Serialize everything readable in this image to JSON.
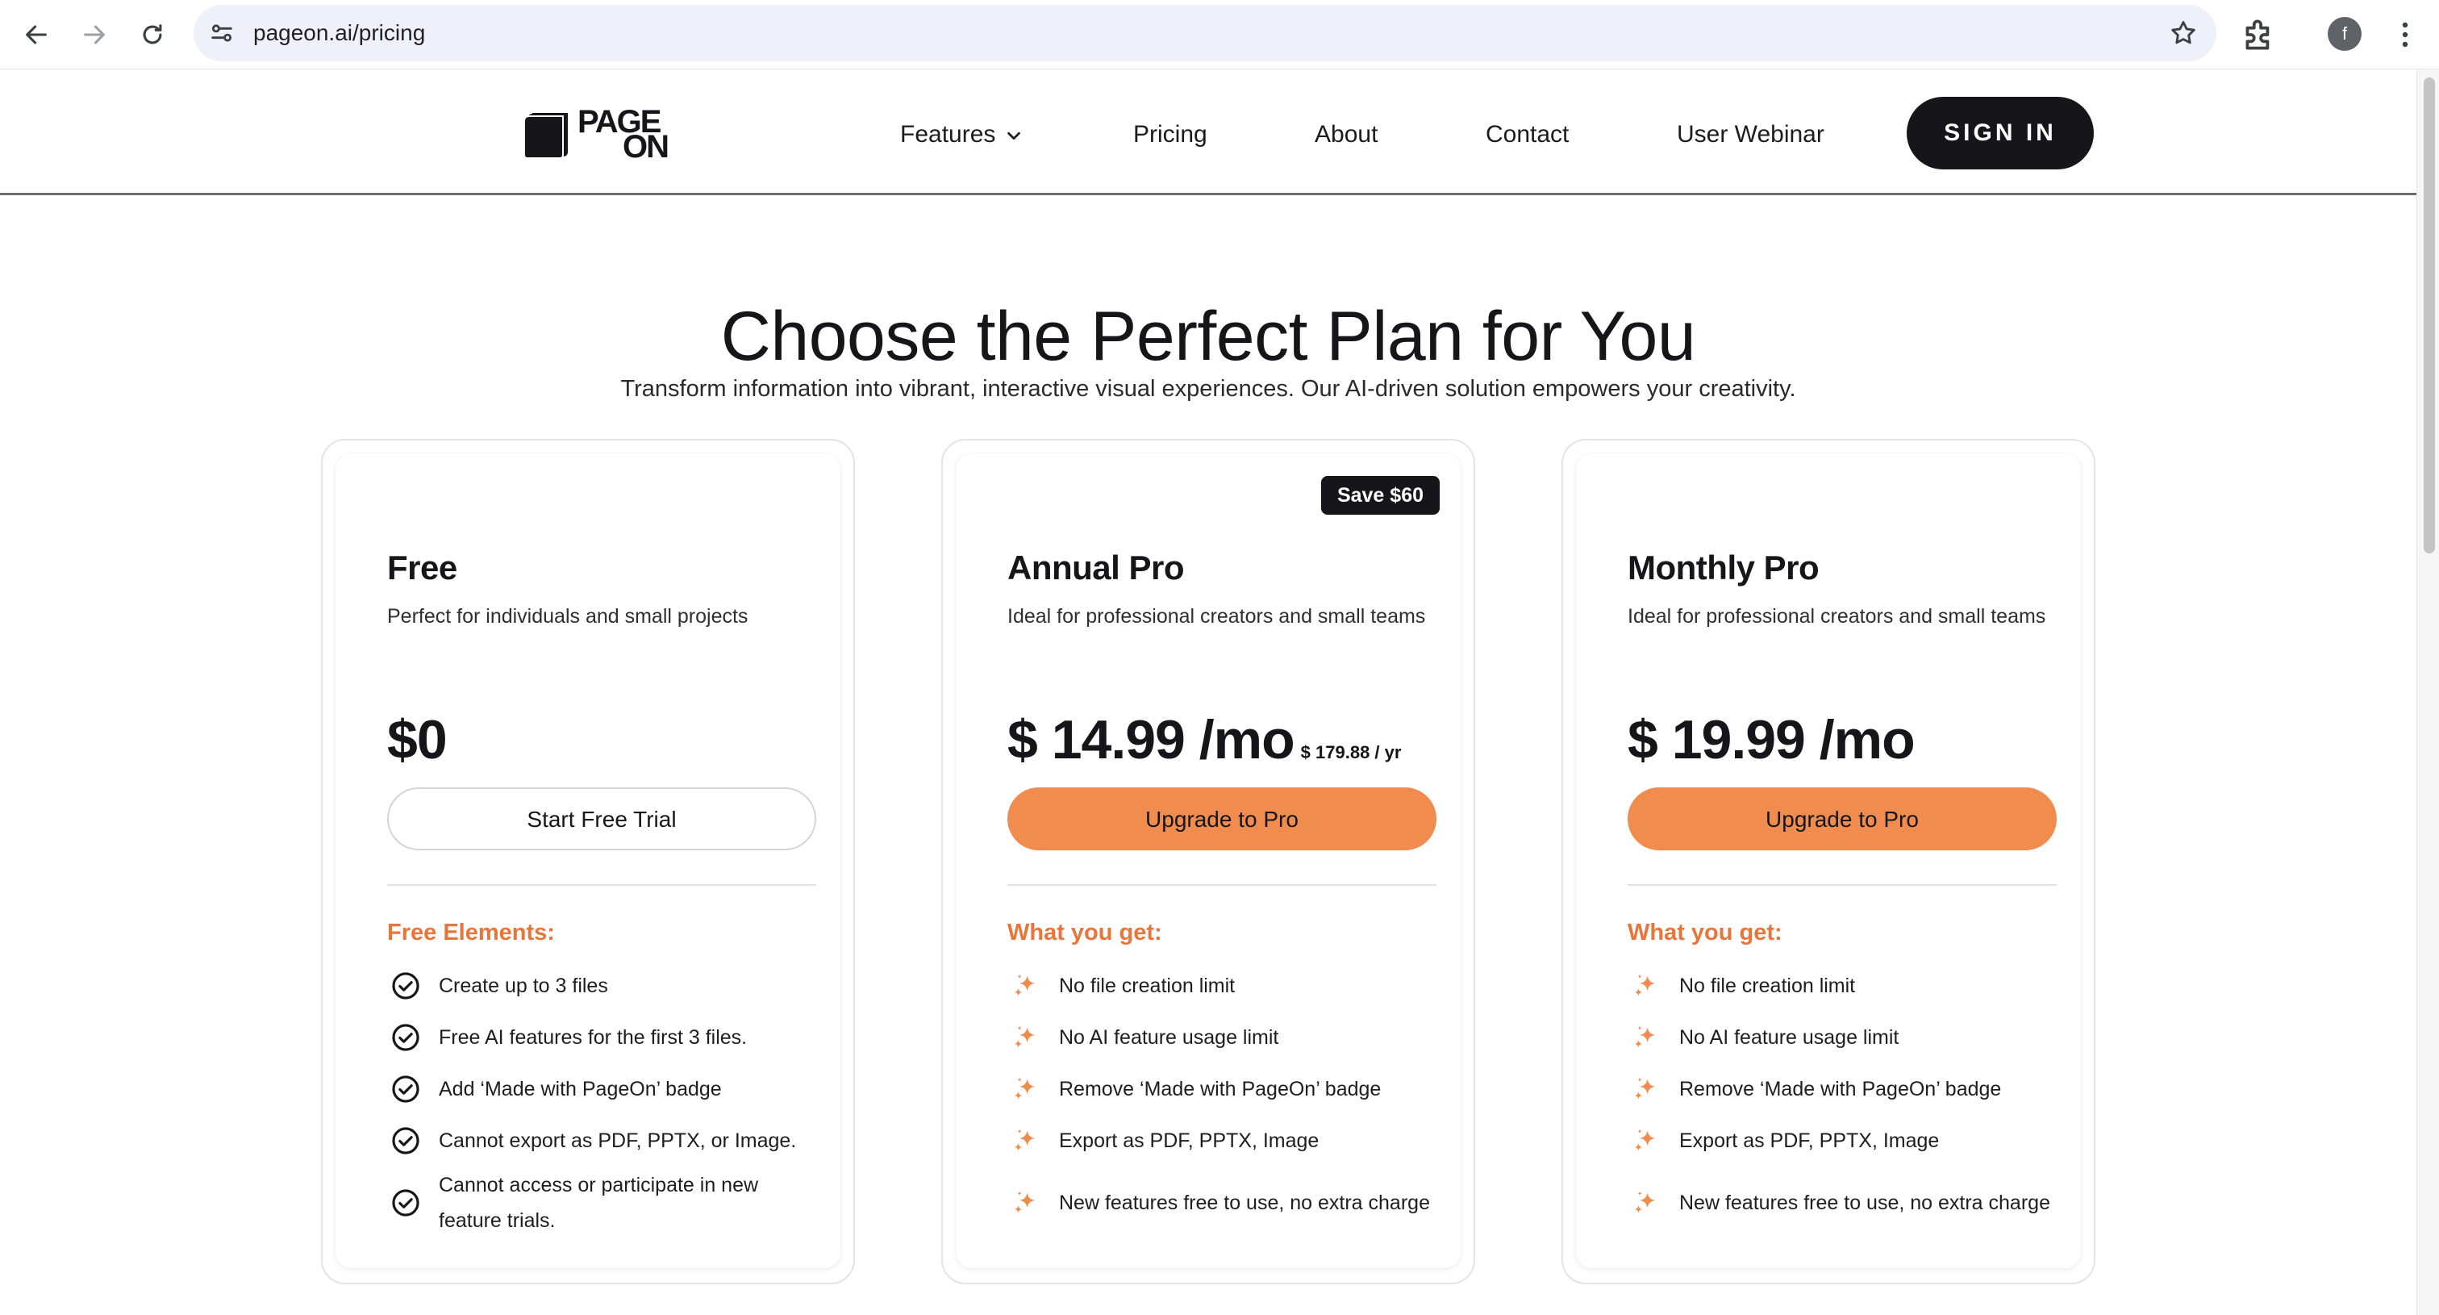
{
  "browser": {
    "url": "pageon.ai/pricing",
    "profile_initial": "f"
  },
  "header": {
    "logo": [
      "PAGE",
      "ON"
    ],
    "nav": [
      {
        "label": "Features",
        "has_dropdown": true
      },
      {
        "label": "Pricing"
      },
      {
        "label": "About"
      },
      {
        "label": "Contact"
      },
      {
        "label": "User Webinar"
      }
    ],
    "signin_label": "SIGN IN"
  },
  "hero": {
    "title": "Choose the Perfect Plan for You",
    "subtitle": "Transform information into vibrant, interactive visual experiences. Our AI-driven solution empowers your creativity."
  },
  "plans": [
    {
      "name": "Free",
      "description": "Perfect for individuals and small projects",
      "price": "$0",
      "cta": "Start Free Trial",
      "section_label": "Free Elements:",
      "features": [
        "Create up to 3 files",
        "Free AI features for the first 3 files.",
        "Add ‘Made with PageOn’ badge",
        "Cannot export as PDF, PPTX, or Image.",
        "Cannot access or participate in new feature trials."
      ]
    },
    {
      "name": "Annual Pro",
      "badge": "Save $60",
      "description": "Ideal for professional creators and small teams",
      "price": "$ 14.99 /mo",
      "price_note": "$ 179.88 / yr",
      "cta": "Upgrade to Pro",
      "section_label": "What you get:",
      "features": [
        "No file creation limit",
        "No AI feature usage limit",
        "Remove ‘Made with PageOn’ badge",
        "Export as PDF, PPTX, Image",
        "New features free to use, no extra charge"
      ]
    },
    {
      "name": "Monthly Pro",
      "description": "Ideal for professional creators and small teams",
      "price": "$ 19.99 /mo",
      "cta": "Upgrade to Pro",
      "section_label": "What you get:",
      "features": [
        "No file creation limit",
        "No AI feature usage limit",
        "Remove ‘Made with PageOn’ badge",
        "Export as PDF, PPTX, Image",
        "New features free to use, no extra charge"
      ]
    }
  ],
  "colors": {
    "accent": "#ef8c4e",
    "accent_text": "#e8753a",
    "dark": "#16161a"
  }
}
